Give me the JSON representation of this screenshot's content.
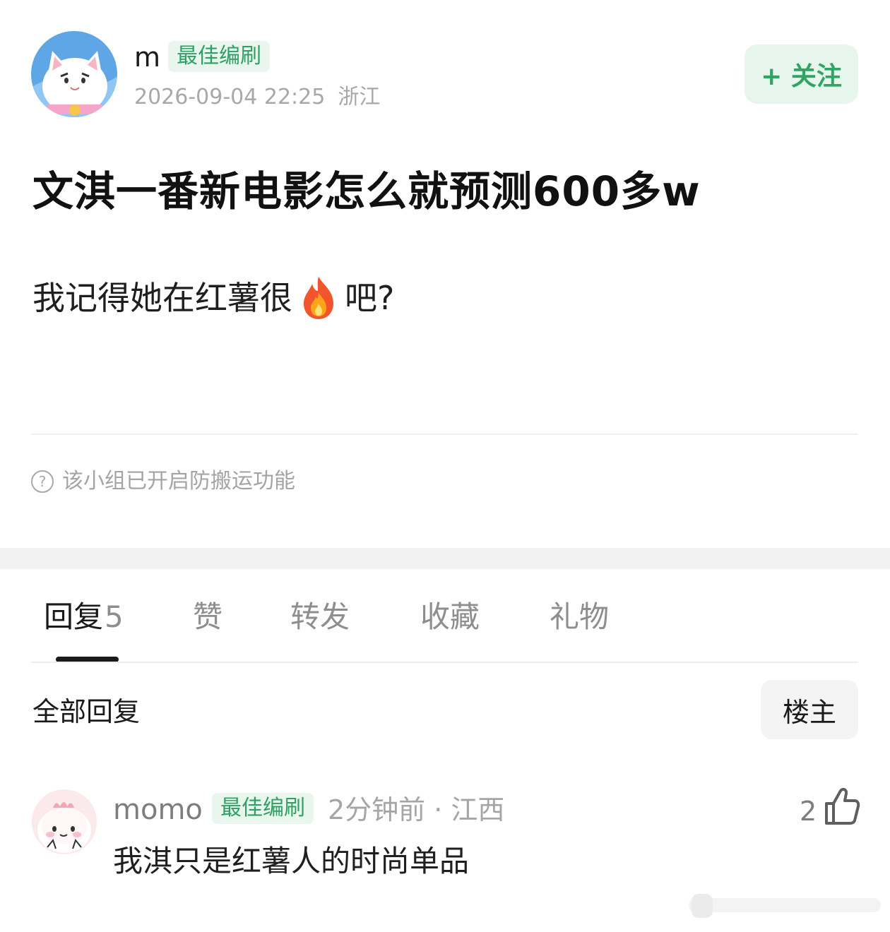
{
  "post": {
    "author": {
      "name": "m",
      "badge": "最佳编刷",
      "timestamp": "2026-09-04 22:25",
      "location": "浙江"
    },
    "follow_label": "+ 关注",
    "title": "文淇一番新电影怎么就预测600多w",
    "body_before": "我记得她在红薯很",
    "body_emoji": "fire-emoji",
    "body_after": "吧?",
    "notice": "该小组已开启防搬运功能",
    "notice_icon": "question-circle-icon"
  },
  "tabs": [
    {
      "label": "回复",
      "count": "5",
      "active": true
    },
    {
      "label": "赞"
    },
    {
      "label": "转发"
    },
    {
      "label": "收藏"
    },
    {
      "label": "礼物"
    }
  ],
  "replies": {
    "header": "全部回复",
    "filter_label": "楼主",
    "items": [
      {
        "user": "momo",
        "badge": "最佳编刷",
        "meta": "2分钟前 · 江西",
        "text": "我淇只是红薯人的时尚单品",
        "likes": "2"
      }
    ]
  },
  "colors": {
    "accent_green": "#2fa463",
    "badge_bg": "#e8f6ee",
    "muted_text": "#a8a8a8"
  }
}
